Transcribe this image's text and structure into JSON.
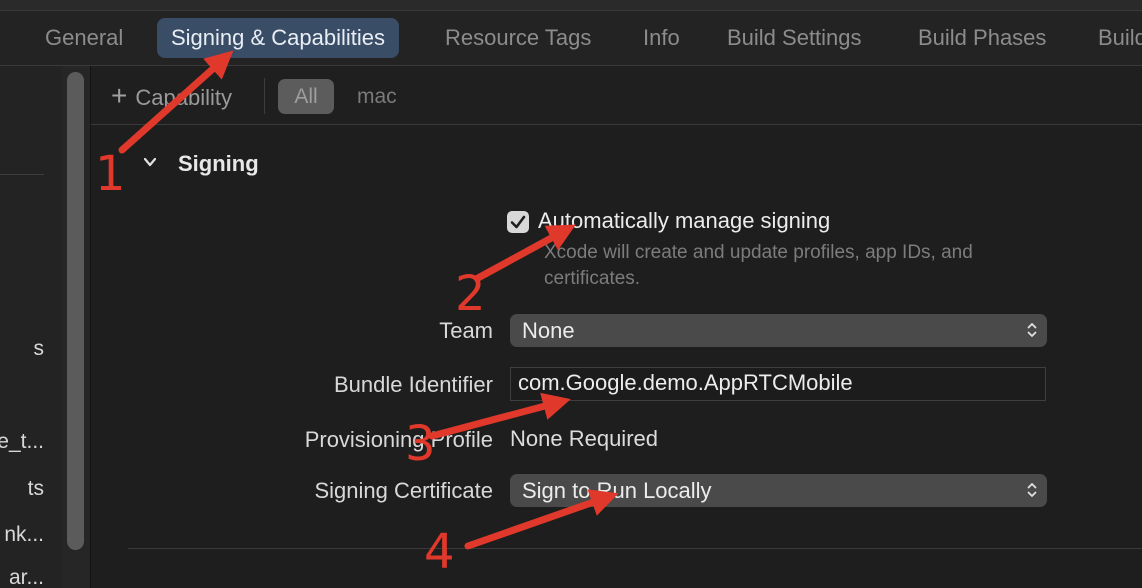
{
  "tabs": [
    {
      "label": "General",
      "active": false
    },
    {
      "label": "Signing & Capabilities",
      "active": true
    },
    {
      "label": "Resource Tags",
      "active": false
    },
    {
      "label": "Info",
      "active": false
    },
    {
      "label": "Build Settings",
      "active": false
    },
    {
      "label": "Build Phases",
      "active": false
    },
    {
      "label": "Build",
      "active": false
    }
  ],
  "sidebar": {
    "fragments": [
      "s",
      "e_t...",
      "ts",
      "nk...",
      "ar..."
    ]
  },
  "filterbar": {
    "add_label": "Capability",
    "filters": [
      "All",
      "mac"
    ],
    "selected_filter": "All"
  },
  "signing": {
    "section_title": "Signing",
    "auto_manage": {
      "checked": true,
      "label": "Automatically manage signing",
      "description": "Xcode will create and update profiles, app IDs, and certificates."
    },
    "team": {
      "label": "Team",
      "value": "None"
    },
    "bundle_identifier": {
      "label": "Bundle Identifier",
      "value": "com.Google.demo.AppRTCMobile"
    },
    "provisioning_profile": {
      "label": "Provisioning Profile",
      "value": "None Required"
    },
    "signing_certificate": {
      "label": "Signing Certificate",
      "value": "Sign to Run Locally"
    }
  },
  "annotations": {
    "color": "#e0392b",
    "numbers": [
      "1",
      "2",
      "3",
      "4"
    ]
  },
  "colors": {
    "background": "#1e1e1e",
    "active_tab": "#3a4d66",
    "popup": "#4a4a4a",
    "annotation": "#e0392b"
  }
}
